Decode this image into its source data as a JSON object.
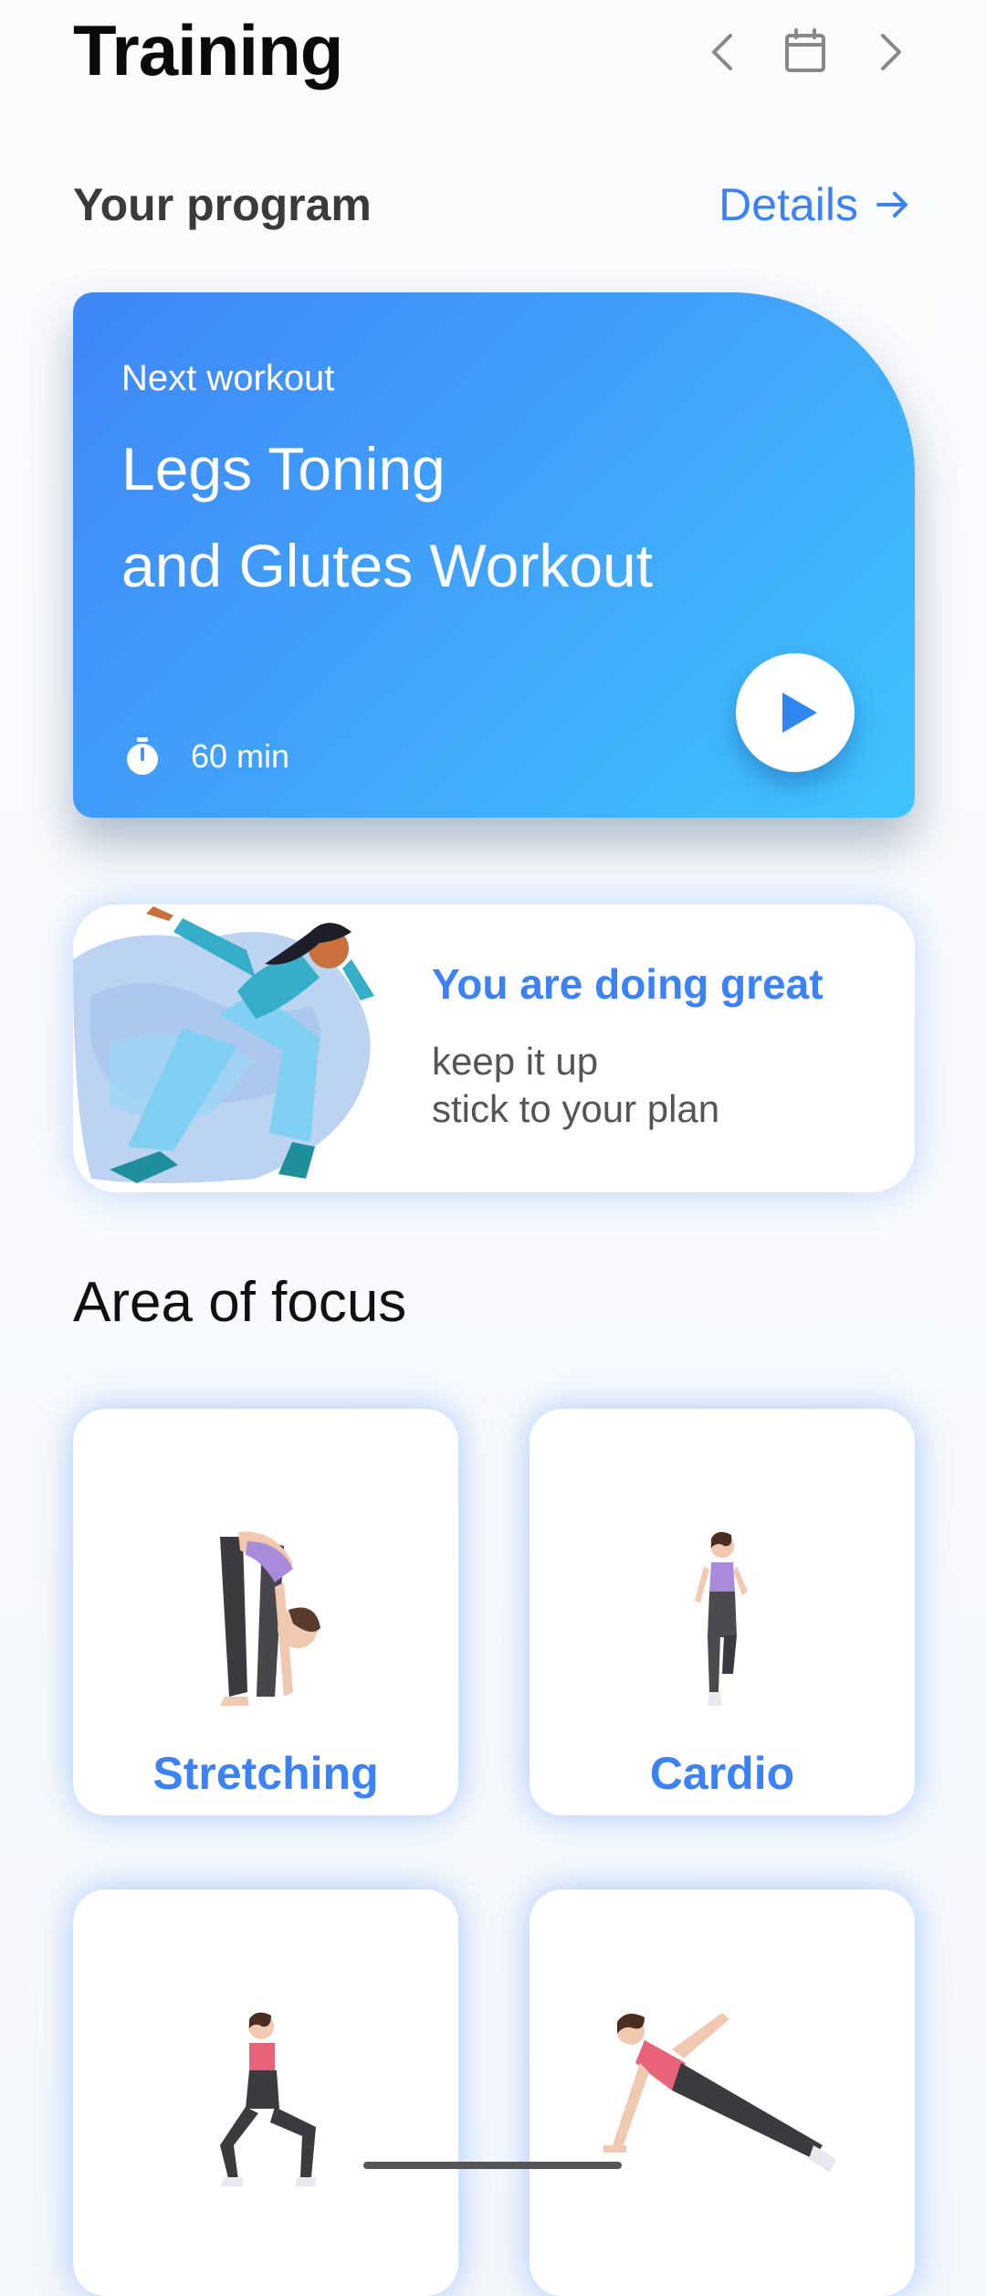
{
  "header": {
    "title": "Training"
  },
  "program": {
    "section_label": "Your program",
    "details_label": "Details"
  },
  "workout": {
    "kicker": "Next workout",
    "title_line1": "Legs Toning",
    "title_line2": "and Glutes Workout",
    "duration": "60 min"
  },
  "motivation": {
    "title": "You are doing great",
    "line1": "keep it up",
    "line2": "stick to your plan"
  },
  "focus": {
    "section_label": "Area of focus",
    "tiles": [
      {
        "label": "Stretching"
      },
      {
        "label": "Cardio"
      },
      {
        "label": ""
      },
      {
        "label": ""
      }
    ]
  },
  "colors": {
    "accent": "#3b82f6",
    "card_start": "#3f86f7",
    "card_end": "#3fc4fd"
  },
  "icons": [
    "chevron-left-icon",
    "calendar-icon",
    "chevron-right-icon",
    "arrow-right-icon",
    "stopwatch-icon",
    "play-icon"
  ]
}
